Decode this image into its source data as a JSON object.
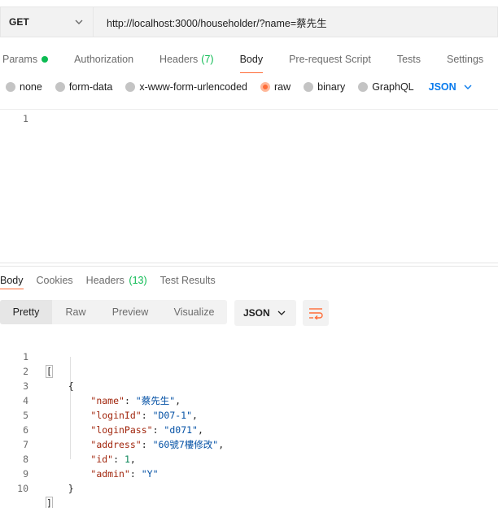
{
  "request": {
    "method": "GET",
    "url": "http://localhost:3000/householder/?name=蔡先生"
  },
  "request_tabs": [
    {
      "label": "Params",
      "extra": ""
    },
    {
      "label": "Authorization",
      "extra": ""
    },
    {
      "label": "Headers",
      "extra": "(7)"
    },
    {
      "label": "Body",
      "extra": ""
    },
    {
      "label": "Pre-request Script",
      "extra": ""
    },
    {
      "label": "Tests",
      "extra": ""
    },
    {
      "label": "Settings",
      "extra": ""
    }
  ],
  "body_types": [
    {
      "label": "none",
      "selected": false
    },
    {
      "label": "form-data",
      "selected": false
    },
    {
      "label": "x-www-form-urlencoded",
      "selected": false
    },
    {
      "label": "raw",
      "selected": true
    },
    {
      "label": "binary",
      "selected": false
    },
    {
      "label": "GraphQL",
      "selected": false
    }
  ],
  "raw_format": "JSON",
  "request_editor": {
    "line_numbers": [
      "1"
    ]
  },
  "response_tabs": [
    {
      "label": "Body",
      "extra": ""
    },
    {
      "label": "Cookies",
      "extra": ""
    },
    {
      "label": "Headers",
      "extra": "(13)"
    },
    {
      "label": "Test Results",
      "extra": ""
    }
  ],
  "view_modes": [
    "Pretty",
    "Raw",
    "Preview",
    "Visualize"
  ],
  "response_format": "JSON",
  "response_code": {
    "line_numbers": [
      "1",
      "2",
      "3",
      "4",
      "5",
      "6",
      "7",
      "8",
      "9",
      "10"
    ],
    "open_array": "[",
    "open_object": "{",
    "fields": [
      {
        "key": "\"name\"",
        "value": "\"蔡先生\"",
        "type": "string",
        "comma": ","
      },
      {
        "key": "\"loginId\"",
        "value": "\"D07-1\"",
        "type": "string",
        "comma": ","
      },
      {
        "key": "\"loginPass\"",
        "value": "\"d071\"",
        "type": "string",
        "comma": ","
      },
      {
        "key": "\"address\"",
        "value": "\"60號7樓修改\"",
        "type": "string",
        "comma": ","
      },
      {
        "key": "\"id\"",
        "value": "1",
        "type": "number",
        "comma": ","
      },
      {
        "key": "\"admin\"",
        "value": "\"Y\"",
        "type": "string",
        "comma": ""
      }
    ],
    "close_object": "}",
    "close_array": "]"
  },
  "colors": {
    "accent": "#ff6c37",
    "green": "#0cbb52",
    "link_blue": "#097bed",
    "json_key": "#a1260d",
    "json_string": "#0451a5",
    "json_number": "#098658"
  }
}
